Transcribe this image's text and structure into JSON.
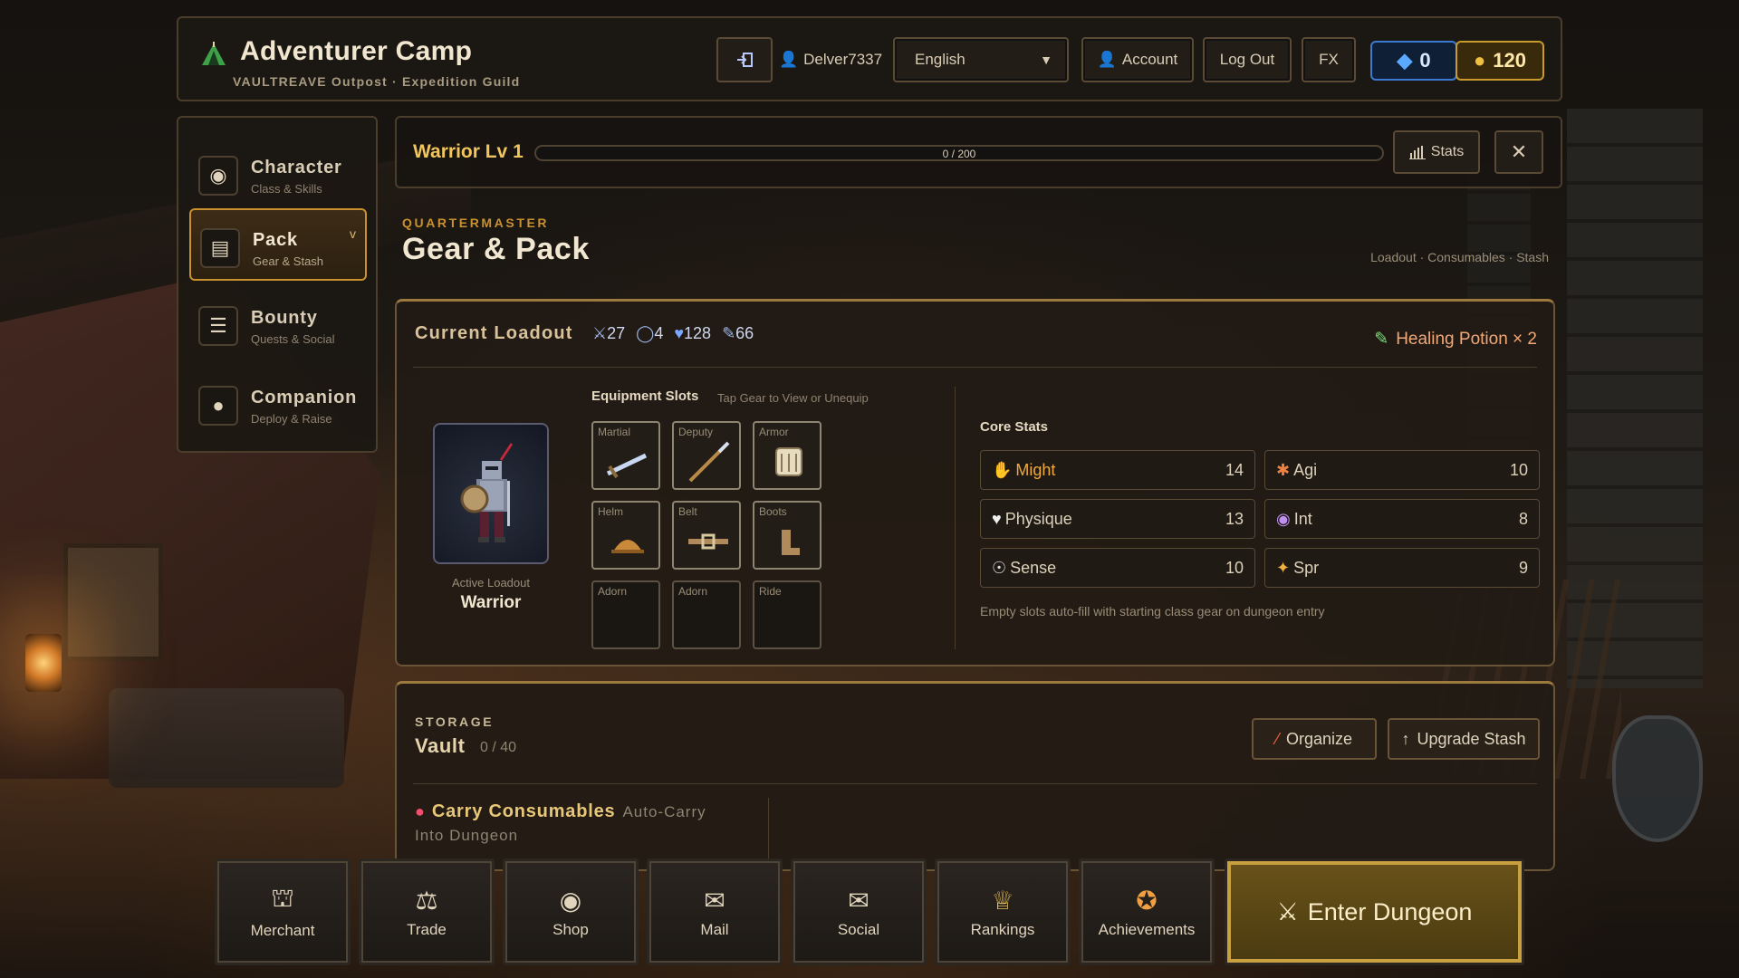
{
  "header": {
    "title": "Adventurer Camp",
    "subtitle": "VAULTREAVE Outpost · Expedition Guild",
    "username": "Delver7337",
    "language": "English",
    "account_label": "Account",
    "logout_label": "Log Out",
    "fx_label": "FX",
    "gems": "0",
    "gold": "120"
  },
  "sidebar": {
    "items": [
      {
        "title": "Character",
        "subtitle": "Class & Skills",
        "icon": "helmet-icon"
      },
      {
        "title": "Pack",
        "subtitle": "Gear & Stash",
        "icon": "backpack-icon",
        "active": true,
        "chevron": "v"
      },
      {
        "title": "Bounty",
        "subtitle": "Quests & Social",
        "icon": "scroll-icon"
      },
      {
        "title": "Companion",
        "subtitle": "Deploy & Raise",
        "icon": "paw-icon"
      }
    ]
  },
  "level": {
    "label": "Warrior Lv 1",
    "xp_text": "0 / 200",
    "xp_fraction": 0,
    "stats_label": "Stats"
  },
  "page": {
    "eyebrow": "QUARTERMASTER",
    "title": "Gear & Pack",
    "crumbs": "Loadout · Consumables · Stash"
  },
  "loadout": {
    "title": "Current Loadout",
    "attack": "27",
    "defense": "4",
    "health": "128",
    "power": "66",
    "potion": "Healing Potion × 2",
    "active_label": "Active Loadout",
    "active_name": "Warrior",
    "equipment_title": "Equipment Slots",
    "equipment_hint": "Tap Gear to View or Unequip",
    "slots": [
      {
        "label": "Martial",
        "filled": true,
        "icon": "sword-icon"
      },
      {
        "label": "Deputy",
        "filled": true,
        "icon": "dagger-icon"
      },
      {
        "label": "Armor",
        "filled": true,
        "icon": "chest-armor-icon"
      },
      {
        "label": "Helm",
        "filled": true,
        "icon": "helm-icon"
      },
      {
        "label": "Belt",
        "filled": true,
        "icon": "belt-icon"
      },
      {
        "label": "Boots",
        "filled": true,
        "icon": "boots-icon"
      },
      {
        "label": "Adorn",
        "filled": false
      },
      {
        "label": "Adorn",
        "filled": false
      },
      {
        "label": "Ride",
        "filled": false
      }
    ],
    "core_title": "Core Stats",
    "stats": [
      {
        "name": "Might",
        "value": "14",
        "icon": "fist-icon"
      },
      {
        "name": "Agi",
        "value": "10",
        "icon": "running-icon"
      },
      {
        "name": "Physique",
        "value": "13",
        "icon": "heart-icon"
      },
      {
        "name": "Int",
        "value": "8",
        "icon": "mage-icon"
      },
      {
        "name": "Sense",
        "value": "10",
        "icon": "eye-icon"
      },
      {
        "name": "Spr",
        "value": "9",
        "icon": "sparkle-icon"
      }
    ],
    "core_note": "Empty slots auto-fill with starting class gear on dungeon entry"
  },
  "storage": {
    "eyebrow": "STORAGE",
    "title": "Vault",
    "count": "0 / 40",
    "organize_label": "Organize",
    "upgrade_label": "Upgrade Stash",
    "carry_title": "Carry Consumables",
    "carry_sub": "Auto-Carry",
    "carry_sub2": "Into Dungeon"
  },
  "bottom_nav": {
    "items": [
      {
        "label": "Merchant",
        "icon": "merchant-icon"
      },
      {
        "label": "Trade",
        "icon": "scales-icon"
      },
      {
        "label": "Shop",
        "icon": "coin-bag-icon"
      },
      {
        "label": "Mail",
        "icon": "envelope-icon"
      },
      {
        "label": "Social",
        "icon": "chat-icon"
      },
      {
        "label": "Rankings",
        "icon": "trophy-icon"
      },
      {
        "label": "Achievements",
        "icon": "medal-icon"
      }
    ],
    "enter_label": "Enter Dungeon"
  },
  "colors": {
    "accent_gold": "#c8902f",
    "gem_blue": "#3b7ad0",
    "might_orange": "#f0a840"
  }
}
